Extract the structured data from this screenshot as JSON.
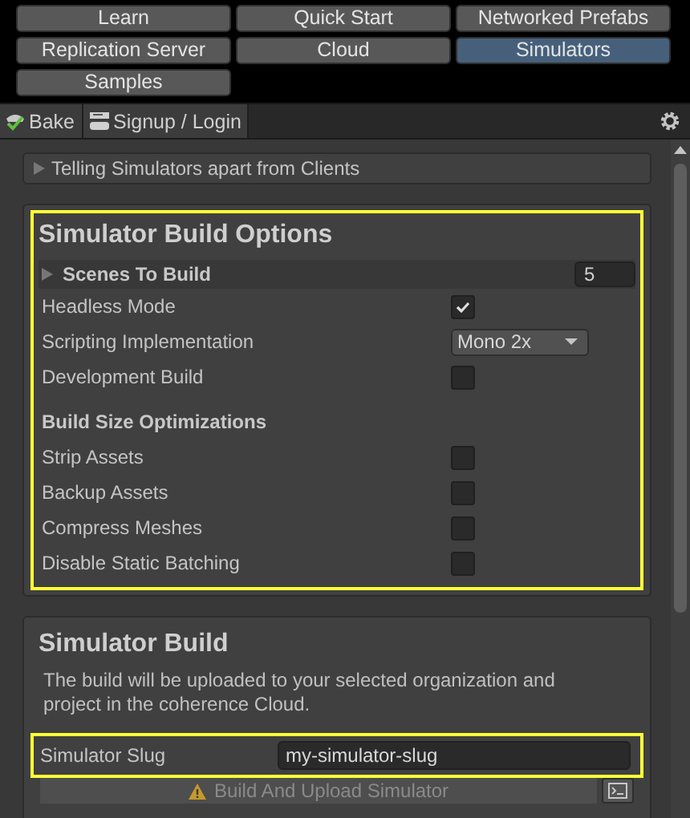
{
  "top_buttons": [
    {
      "label": "Learn",
      "selected": false
    },
    {
      "label": "Quick Start",
      "selected": false
    },
    {
      "label": "Networked Prefabs",
      "selected": false
    },
    {
      "label": "Replication Server",
      "selected": false
    },
    {
      "label": "Cloud",
      "selected": false
    },
    {
      "label": "Simulators",
      "selected": true
    },
    {
      "label": "Samples",
      "selected": false
    }
  ],
  "tabs": [
    {
      "label": "Bake",
      "kind": "bake"
    },
    {
      "label": "Signup / Login",
      "kind": "login"
    }
  ],
  "foldout": {
    "label": "Telling Simulators apart from Clients",
    "expanded": false
  },
  "build_options": {
    "title": "Simulator Build Options",
    "highlighted": true,
    "scenes": {
      "label": "Scenes To Build",
      "expanded": false,
      "value": "5"
    },
    "rows": [
      {
        "kind": "checkbox",
        "label": "Headless Mode",
        "checked": true
      },
      {
        "kind": "dropdown",
        "label": "Scripting Implementation",
        "value": "Mono 2x"
      },
      {
        "kind": "checkbox",
        "label": "Development Build",
        "checked": false
      },
      {
        "kind": "heading",
        "label": "Build Size Optimizations"
      },
      {
        "kind": "checkbox",
        "label": "Strip Assets",
        "checked": false
      },
      {
        "kind": "checkbox",
        "label": "Backup Assets",
        "checked": false
      },
      {
        "kind": "checkbox",
        "label": "Compress Meshes",
        "checked": false
      },
      {
        "kind": "checkbox",
        "label": "Disable Static Batching",
        "checked": false
      }
    ]
  },
  "simulator_build": {
    "title": "Simulator Build",
    "description": "The build will be uploaded to your selected organization and project in the coherence Cloud.",
    "slug": {
      "label": "Simulator Slug",
      "value": "my-simulator-slug",
      "highlighted": true
    },
    "build_button": {
      "label": "Build And Upload Simulator",
      "disabled": true
    }
  }
}
